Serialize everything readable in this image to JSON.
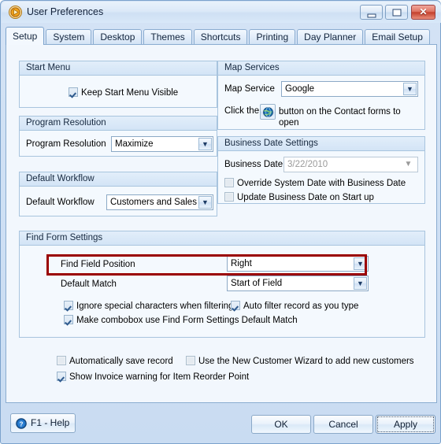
{
  "window": {
    "title": "User Preferences",
    "icon": "app-play-circle-icon",
    "controls": {
      "minimize": "–",
      "maximize": "□",
      "close": "✕"
    }
  },
  "tabs": [
    {
      "label": "Setup",
      "active": true
    },
    {
      "label": "System",
      "active": false
    },
    {
      "label": "Desktop",
      "active": false
    },
    {
      "label": "Themes",
      "active": false
    },
    {
      "label": "Shortcuts",
      "active": false
    },
    {
      "label": "Printing",
      "active": false
    },
    {
      "label": "Day Planner",
      "active": false
    },
    {
      "label": "Email Setup",
      "active": false
    }
  ],
  "groups": {
    "start_menu": {
      "title": "Start Menu",
      "keep_visible_label": "Keep Start Menu Visible",
      "keep_visible_checked": true
    },
    "program_resolution": {
      "title": "Program Resolution",
      "field_label": "Program Resolution",
      "value": "Maximize"
    },
    "default_workflow": {
      "title": "Default Workflow",
      "field_label": "Default Workflow",
      "value": "Customers and Sales"
    },
    "map_services": {
      "title": "Map Services",
      "field_label": "Map Service",
      "value": "Google",
      "hint_before": "Click the",
      "hint_after": "button on the Contact forms to open",
      "button_icon": "globe-icon"
    },
    "business_date": {
      "title": "Business Date Settings",
      "field_label": "Business Date",
      "value": "3/22/2010",
      "override_label": "Override System Date with Business Date",
      "override_checked": false,
      "update_label": "Update Business Date on Start up",
      "update_checked": false
    },
    "find_form": {
      "title": "Find Form Settings",
      "find_field_position_label": "Find Field Position",
      "find_field_position_value": "Right",
      "default_match_label": "Default Match",
      "default_match_value": "Start of Field",
      "ignore_special_label": "Ignore special characters when filtering",
      "ignore_special_checked": true,
      "auto_filter_label": "Auto filter record as you type",
      "auto_filter_checked": true,
      "make_combobox_label": "Make combobox use Find Form Settings Default Match",
      "make_combobox_checked": true
    }
  },
  "misc_options": {
    "auto_save_label": "Automatically save record",
    "auto_save_checked": false,
    "new_customer_wizard_label": "Use the New Customer Wizard to add new customers",
    "new_customer_wizard_checked": false,
    "invoice_warning_label": "Show Invoice warning for Item Reorder Point",
    "invoice_warning_checked": true
  },
  "footer": {
    "help_label": "F1 - Help",
    "help_icon": "question-circle-icon",
    "ok_label": "OK",
    "cancel_label": "Cancel",
    "apply_label": "Apply"
  },
  "colors": {
    "highlight_box": "#9a0000",
    "window_border": "#7ba2cc",
    "group_border": "#a8c4de",
    "panel_bg": "#f2f7fd"
  }
}
